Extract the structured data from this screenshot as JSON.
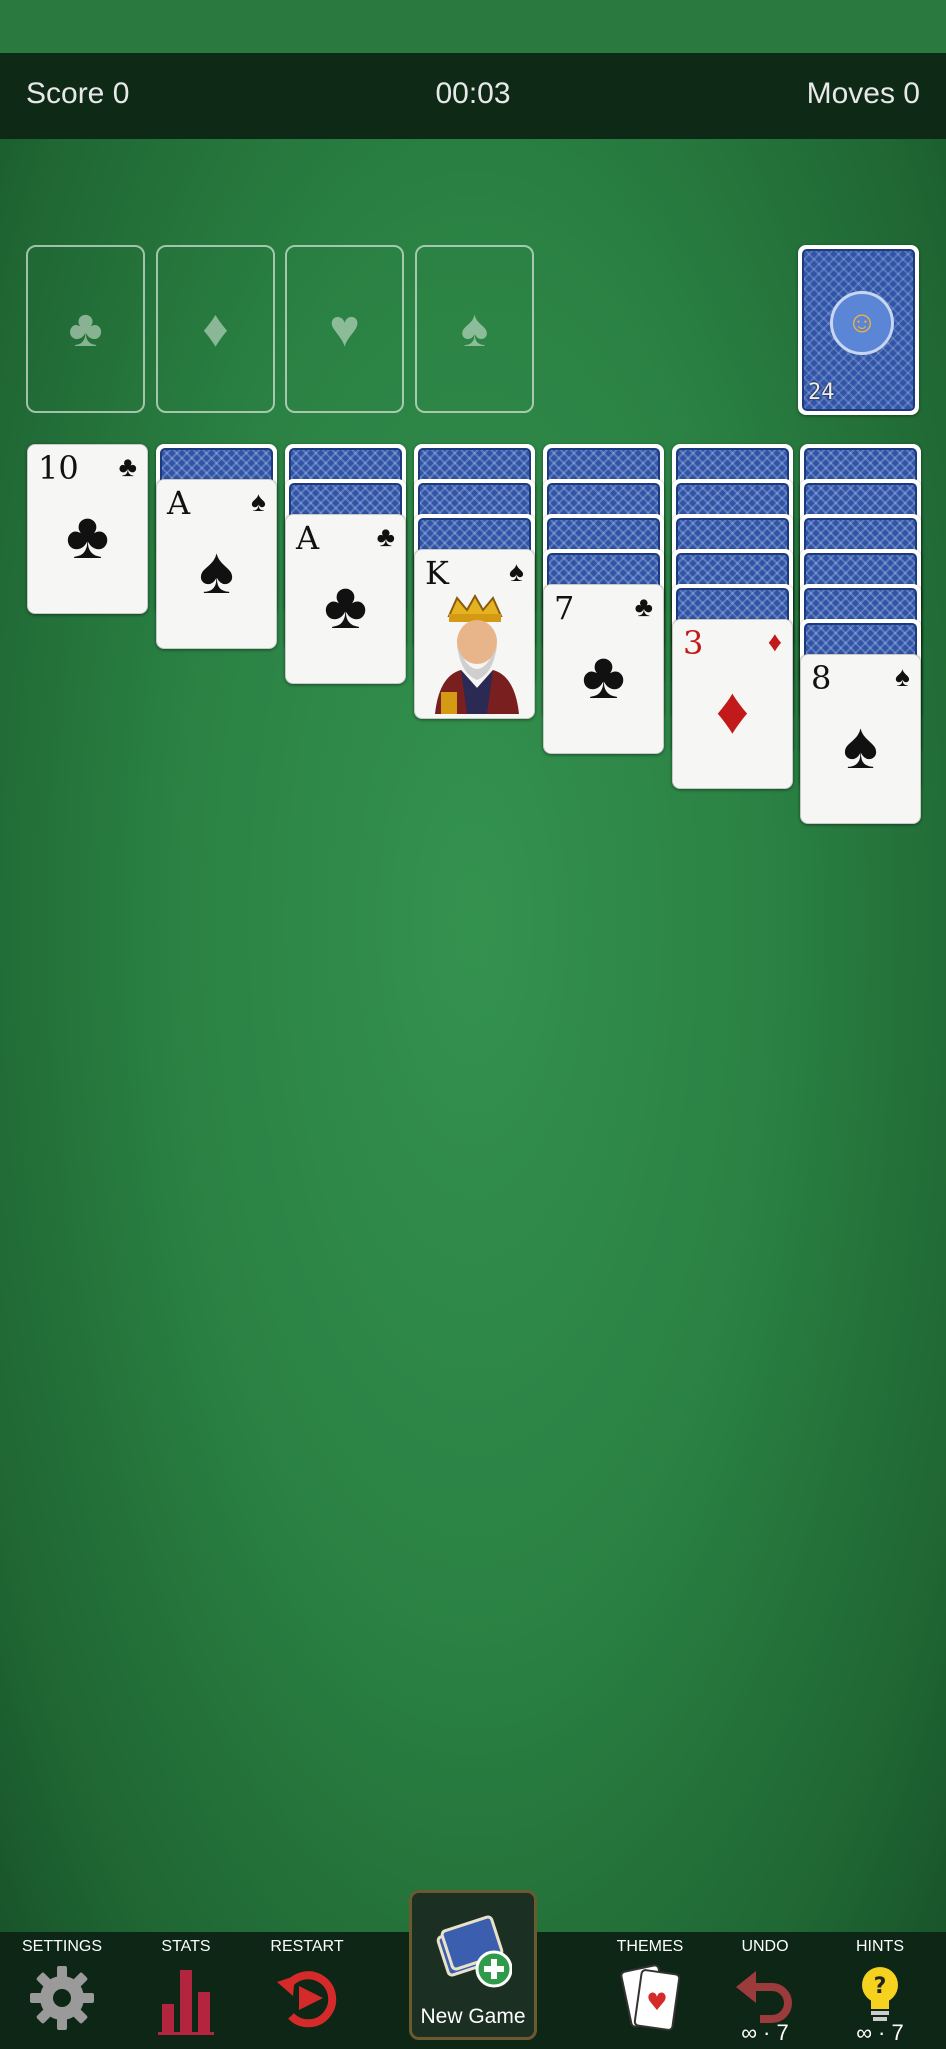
{
  "header": {
    "score": "Score 0",
    "timer": "00:03",
    "moves": "Moves 0"
  },
  "foundations": [
    {
      "suit": "♣",
      "icon": "club-icon"
    },
    {
      "suit": "♦",
      "icon": "diamond-icon"
    },
    {
      "suit": "♥",
      "icon": "heart-icon"
    },
    {
      "suit": "♠",
      "icon": "spade-icon"
    }
  ],
  "stock": {
    "count": "24"
  },
  "tableau": [
    {
      "hidden": 0,
      "rank": "10",
      "suit": "♣",
      "color": "black"
    },
    {
      "hidden": 1,
      "rank": "A",
      "suit": "♠",
      "color": "black"
    },
    {
      "hidden": 2,
      "rank": "A",
      "suit": "♣",
      "color": "black"
    },
    {
      "hidden": 3,
      "rank": "K",
      "suit": "♠",
      "color": "black"
    },
    {
      "hidden": 4,
      "rank": "7",
      "suit": "♣",
      "color": "black"
    },
    {
      "hidden": 5,
      "rank": "3",
      "suit": "♦",
      "color": "red"
    },
    {
      "hidden": 6,
      "rank": "8",
      "suit": "♠",
      "color": "black"
    }
  ],
  "toolbar": {
    "settings": "SETTINGS",
    "stats": "STATS",
    "restart": "RESTART",
    "new_game": "New Game",
    "themes": "THEMES",
    "undo": "UNDO",
    "undo_count": "∞ · 7",
    "hints": "HINTS",
    "hints_count": "∞ · 7"
  },
  "colors": {
    "felt": "#2a8143",
    "bar": "#0e2a17",
    "card_back": "#2f54a8",
    "red_suit": "#c21a1a"
  }
}
